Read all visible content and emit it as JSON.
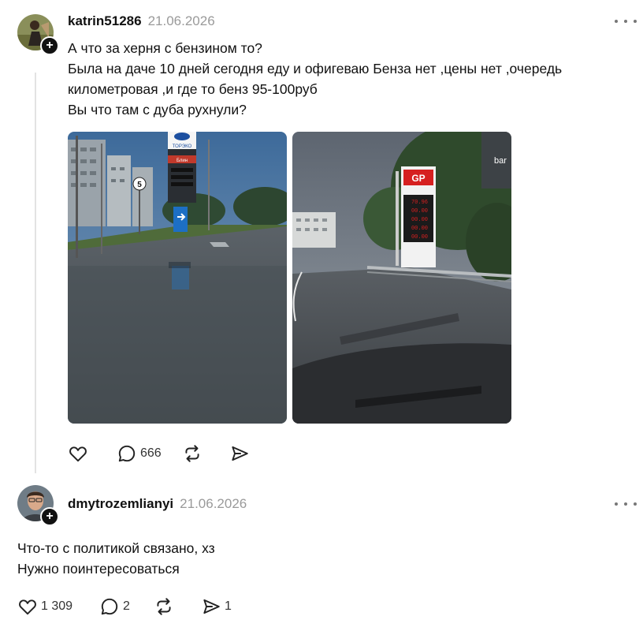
{
  "post1": {
    "username": "katrin51286",
    "date": "21.06.2026",
    "lines": [
      "А что за херня с бензином то?",
      "Была на даче 10 дней сегодня еду и офигеваю Бенза нет ,цены нет ,очередь",
      "километровая ,и где то бенз 95-100руб",
      "Вы что там с дуба рухнули?"
    ],
    "photo1_sign": {
      "brand": "ТОРЭКО",
      "row": "Блин",
      "speed": "5"
    },
    "photo2_sign": {
      "brand": "GP",
      "prices": [
        "70.96",
        "00.00",
        "00.00",
        "00.00",
        "00.00"
      ],
      "corner_text": "bar"
    },
    "actions": {
      "like_count": "",
      "reply_count": "666",
      "repost_count": "",
      "share_count": ""
    }
  },
  "post2": {
    "username": "dmytrozemlianyi",
    "date": "21.06.2026",
    "lines": [
      "Что-то с политикой связано, хз",
      "Нужно поинтересоваться"
    ],
    "actions": {
      "like_count": "1 309",
      "reply_count": "2",
      "repost_count": "",
      "share_count": "1"
    }
  },
  "colors": {
    "text": "#111111",
    "muted": "#9a9a9a",
    "thread_line": "#e3e3e3",
    "price_red": "#d62020"
  },
  "icons": [
    "plus-icon",
    "more-icon",
    "heart-icon",
    "reply-icon",
    "repost-icon",
    "share-icon"
  ]
}
